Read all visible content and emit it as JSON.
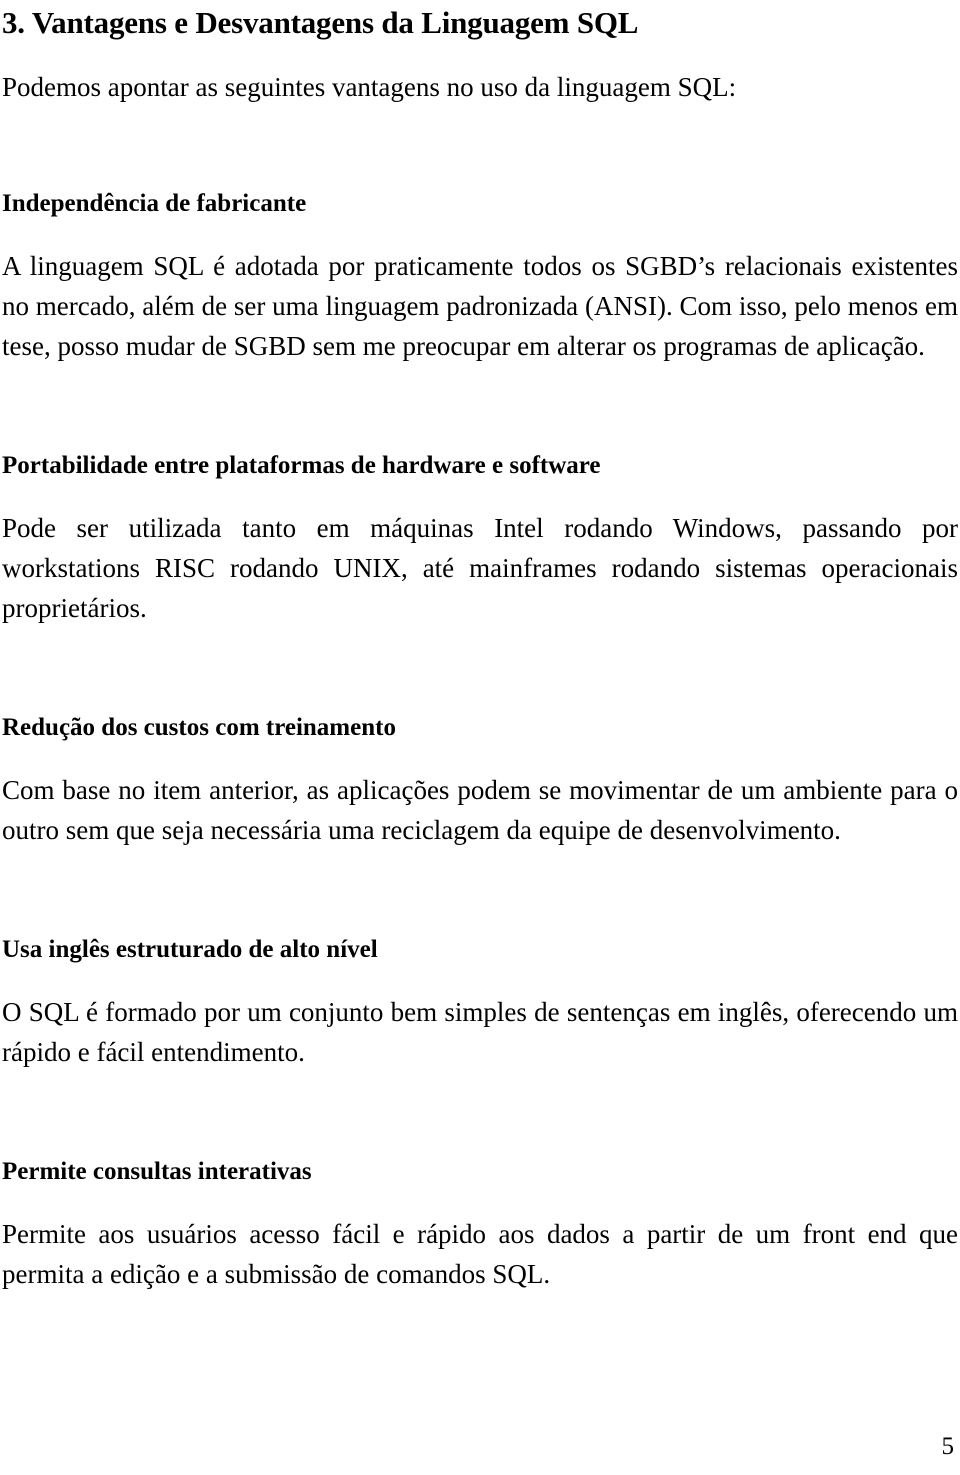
{
  "document": {
    "title": "3. Vantagens e Desvantagens da Linguagem SQL",
    "lead": "Podemos apontar as seguintes vantagens no uso da linguagem SQL:",
    "page_number": "5",
    "text_color": "#000000",
    "background_color": "#ffffff"
  },
  "sections": [
    {
      "heading": "Independência de fabricante",
      "body": "A linguagem SQL é adotada por praticamente todos os SGBD’s relacionais existentes no mercado, além de ser uma linguagem padronizada (ANSI). Com isso, pelo menos em tese, posso mudar de SGBD sem me preocupar em alterar os programas de aplicação."
    },
    {
      "heading": "Portabilidade entre plataformas de hardware e software",
      "body": "Pode ser utilizada tanto em máquinas Intel rodando Windows, passando por workstations RISC rodando UNIX, até mainframes rodando sistemas operacionais proprietários."
    },
    {
      "heading": "Redução dos custos com treinamento",
      "body": "Com base no item anterior, as aplicações podem se movimentar de um ambiente para o outro sem que seja necessária uma reciclagem da equipe de desenvolvimento."
    },
    {
      "heading": "Usa inglês estruturado de alto nível",
      "body": "O SQL é formado por um conjunto bem simples de sentenças em inglês, oferecendo um rápido e fácil entendimento."
    },
    {
      "heading": "Permite consultas interativas",
      "body": "Permite aos usuários acesso fácil e rápido aos dados a partir de um front end que permita a edição e a submissão de comandos SQL."
    }
  ]
}
